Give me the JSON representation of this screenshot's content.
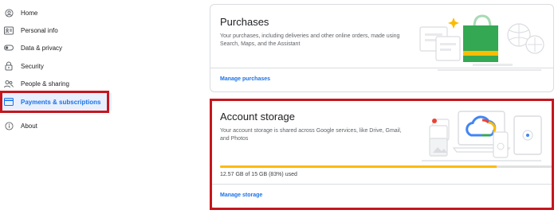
{
  "sidebar": {
    "items": [
      {
        "label": "Home",
        "icon": "account-circle-icon"
      },
      {
        "label": "Personal info",
        "icon": "id-card-icon"
      },
      {
        "label": "Data & privacy",
        "icon": "toggle-icon"
      },
      {
        "label": "Security",
        "icon": "lock-icon"
      },
      {
        "label": "People & sharing",
        "icon": "people-icon"
      },
      {
        "label": "Payments & subscriptions",
        "icon": "credit-card-icon",
        "active": true
      },
      {
        "label": "About",
        "icon": "info-icon"
      }
    ]
  },
  "purchases": {
    "title": "Purchases",
    "description": "Your purchases, including deliveries and other online orders, made using Search, Maps, and the Assistant",
    "link": "Manage purchases"
  },
  "storage": {
    "title": "Account storage",
    "description": "Your account storage is shared across Google services, like Drive, Gmail, and Photos",
    "usage": "12.57 GB of 15 GB (83%) used",
    "usage_fraction": 0.83,
    "link": "Manage storage"
  },
  "colors": {
    "accent": "#1a73e8",
    "highlight": "#c5161d",
    "progress": "#fbbc04"
  }
}
